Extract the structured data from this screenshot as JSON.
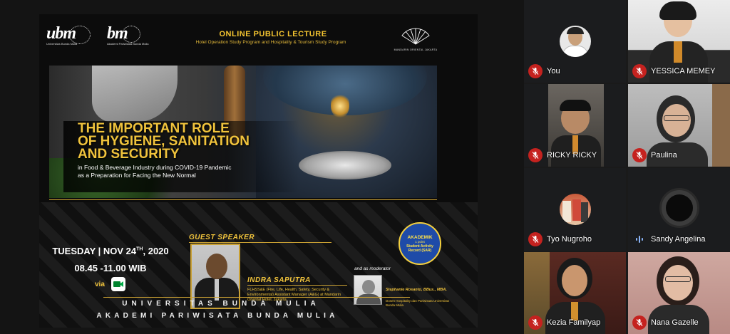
{
  "slide": {
    "logo_left": "ubm",
    "logo_left_sub": "Universitas Bunda Mulia",
    "logo_right": "bm",
    "logo_right_sub": "Akademi Pariwisata Bunda Mulia",
    "header_title": "ONLINE PUBLIC LECTURE",
    "header_subtitle": "Hotel Operation Study Program and Hospitality & Tourism Study Program",
    "partner_logo_text": "MANDARIN ORIENTAL JAKARTA",
    "main_title_line1": "THE IMPORTANT ROLE",
    "main_title_line2": "OF HYGIENE, SANITATION",
    "main_title_line3": "AND SECURITY",
    "main_subtitle_line1": "in Food & Beverage Industry during COVID-19 Pandemic",
    "main_subtitle_line2": "as a Preparation for Facing the New Normal",
    "date_prefix": "TUESDAY | NOV 24",
    "date_sup": "TH",
    "date_suffix": ", 2020",
    "time": "08.45 -11.00 WIB",
    "via_label": "via",
    "guest_speaker_label": "GUEST SPEAKER",
    "speaker_name": "INDRA SAPUTRA",
    "speaker_title": "FLHSS&E (Fire, Life, Health, Safety, Security & Environmental) Assistant Manager (A&G) at Mandarin Oriental Hotel, Jakarta",
    "moderator_label": "and as moderator",
    "moderator_name": "Stephanie Rosanto, BBus., MBA.",
    "moderator_title": "Dosen Hospitality dan Pariwisata Universitas Bunda Mulia",
    "badge_line1": "AKADEMIK",
    "badge_line2": "1 point",
    "badge_line3": "Student Activity Record (SAR)",
    "footer_line1": "UNIVERSITAS BUNDA MULIA",
    "footer_line2": "AKADEMI PARIWISATA BUNDA MULIA"
  },
  "participants": [
    {
      "name": "You",
      "muted": true
    },
    {
      "name": "YESSICA MEMEY",
      "muted": true
    },
    {
      "name": "RICKY RICKY",
      "muted": true
    },
    {
      "name": "Paulina",
      "muted": true
    },
    {
      "name": "Tyo Nugroho",
      "muted": true
    },
    {
      "name": "Sandy Angelina",
      "muted": false
    },
    {
      "name": "Kezia Familyap",
      "muted": true
    },
    {
      "name": "Nana Gazelle",
      "muted": true
    }
  ],
  "colors": {
    "gold": "#f0c33c",
    "mic_muted": "#c5221f",
    "tile_bg": "#202124",
    "speaking": "#8ab4f8"
  }
}
